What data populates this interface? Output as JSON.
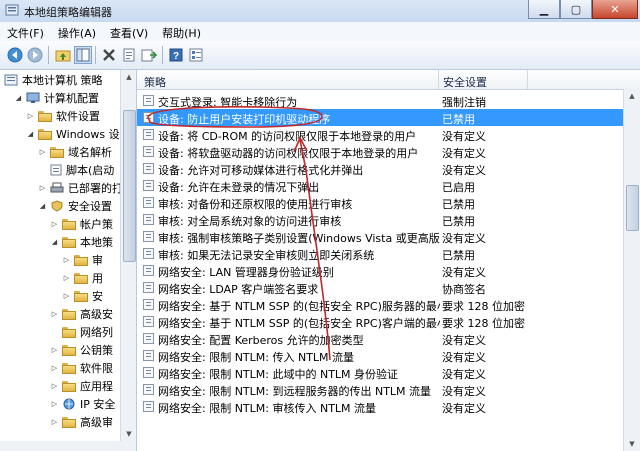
{
  "window": {
    "title": "本地组策略编辑器",
    "minimize": "▁",
    "maximize": "▢",
    "close": "✕",
    "accent": "#3399ff",
    "annotation_color": "#c0282a"
  },
  "menu": {
    "items": [
      {
        "label": "文件(F)"
      },
      {
        "label": "操作(A)"
      },
      {
        "label": "查看(V)"
      },
      {
        "label": "帮助(H)"
      }
    ]
  },
  "toolbar": {
    "icons": [
      "back-icon",
      "forward-icon",
      "folder-up-icon",
      "show-hide-tree-icon",
      "delete-icon",
      "properties-icon",
      "export-icon",
      "help-icon",
      "details-view-icon"
    ]
  },
  "tree": {
    "items": [
      {
        "label": "本地计算机 策略"
      },
      {
        "label": "计算机配置"
      },
      {
        "label": "软件设置"
      },
      {
        "label": "Windows 设"
      },
      {
        "label": "域名解析"
      },
      {
        "label": "脚本(启动"
      },
      {
        "label": "已部署的打"
      },
      {
        "label": "安全设置"
      },
      {
        "label": "帐户策"
      },
      {
        "label": "本地策"
      },
      {
        "label": "审"
      },
      {
        "label": "用"
      },
      {
        "label": "安"
      },
      {
        "label": "高级安"
      },
      {
        "label": "网络列"
      },
      {
        "label": "公钥策"
      },
      {
        "label": "软件限"
      },
      {
        "label": "应用程"
      },
      {
        "label": "IP 安全"
      },
      {
        "label": "高级审"
      }
    ]
  },
  "list": {
    "columns": [
      "策略",
      "安全设置"
    ],
    "rows": [
      {
        "policy": "交互式登录: 智能卡移除行为",
        "setting": "强制注销"
      },
      {
        "policy": "设备: 防止用户安装打印机驱动程序",
        "setting": "已禁用"
      },
      {
        "policy": "设备: 将 CD-ROM 的访问权限仅限于本地登录的用户",
        "setting": "没有定义"
      },
      {
        "policy": "设备: 将软盘驱动器的访问权限仅限于本地登录的用户",
        "setting": "没有定义"
      },
      {
        "policy": "设备: 允许对可移动媒体进行格式化并弹出",
        "setting": "没有定义"
      },
      {
        "policy": "设备: 允许在未登录的情况下弹出",
        "setting": "已启用"
      },
      {
        "policy": "审核: 对备份和还原权限的使用进行审核",
        "setting": "已禁用"
      },
      {
        "policy": "审核: 对全局系统对象的访问进行审核",
        "setting": "已禁用"
      },
      {
        "policy": "审核: 强制审核策略子类别设置(Windows Vista 或更高版本...",
        "setting": "没有定义"
      },
      {
        "policy": "审核: 如果无法记录安全审核则立即关闭系统",
        "setting": "已禁用"
      },
      {
        "policy": "网络安全: LAN 管理器身份验证级别",
        "setting": "没有定义"
      },
      {
        "policy": "网络安全: LDAP 客户端签名要求",
        "setting": "协商签名"
      },
      {
        "policy": "网络安全: 基于 NTLM SSP 的(包括安全 RPC)服务器的最小...",
        "setting": "要求 128 位加密"
      },
      {
        "policy": "网络安全: 基于 NTLM SSP 的(包括安全 RPC)客户端的最小...",
        "setting": "要求 128 位加密"
      },
      {
        "policy": "网络安全: 配置 Kerberos 允许的加密类型",
        "setting": "没有定义"
      },
      {
        "policy": "网络安全: 限制 NTLM: 传入 NTLM 流量",
        "setting": "没有定义"
      },
      {
        "policy": "网络安全: 限制 NTLM: 此域中的 NTLM 身份验证",
        "setting": "没有定义"
      },
      {
        "policy": "网络安全: 限制 NTLM: 到远程服务器的传出 NTLM 流量",
        "setting": "没有定义"
      },
      {
        "policy": "网络安全: 限制 NTLM: 审核传入 NTLM 流量",
        "setting": "没有定义"
      }
    ]
  }
}
